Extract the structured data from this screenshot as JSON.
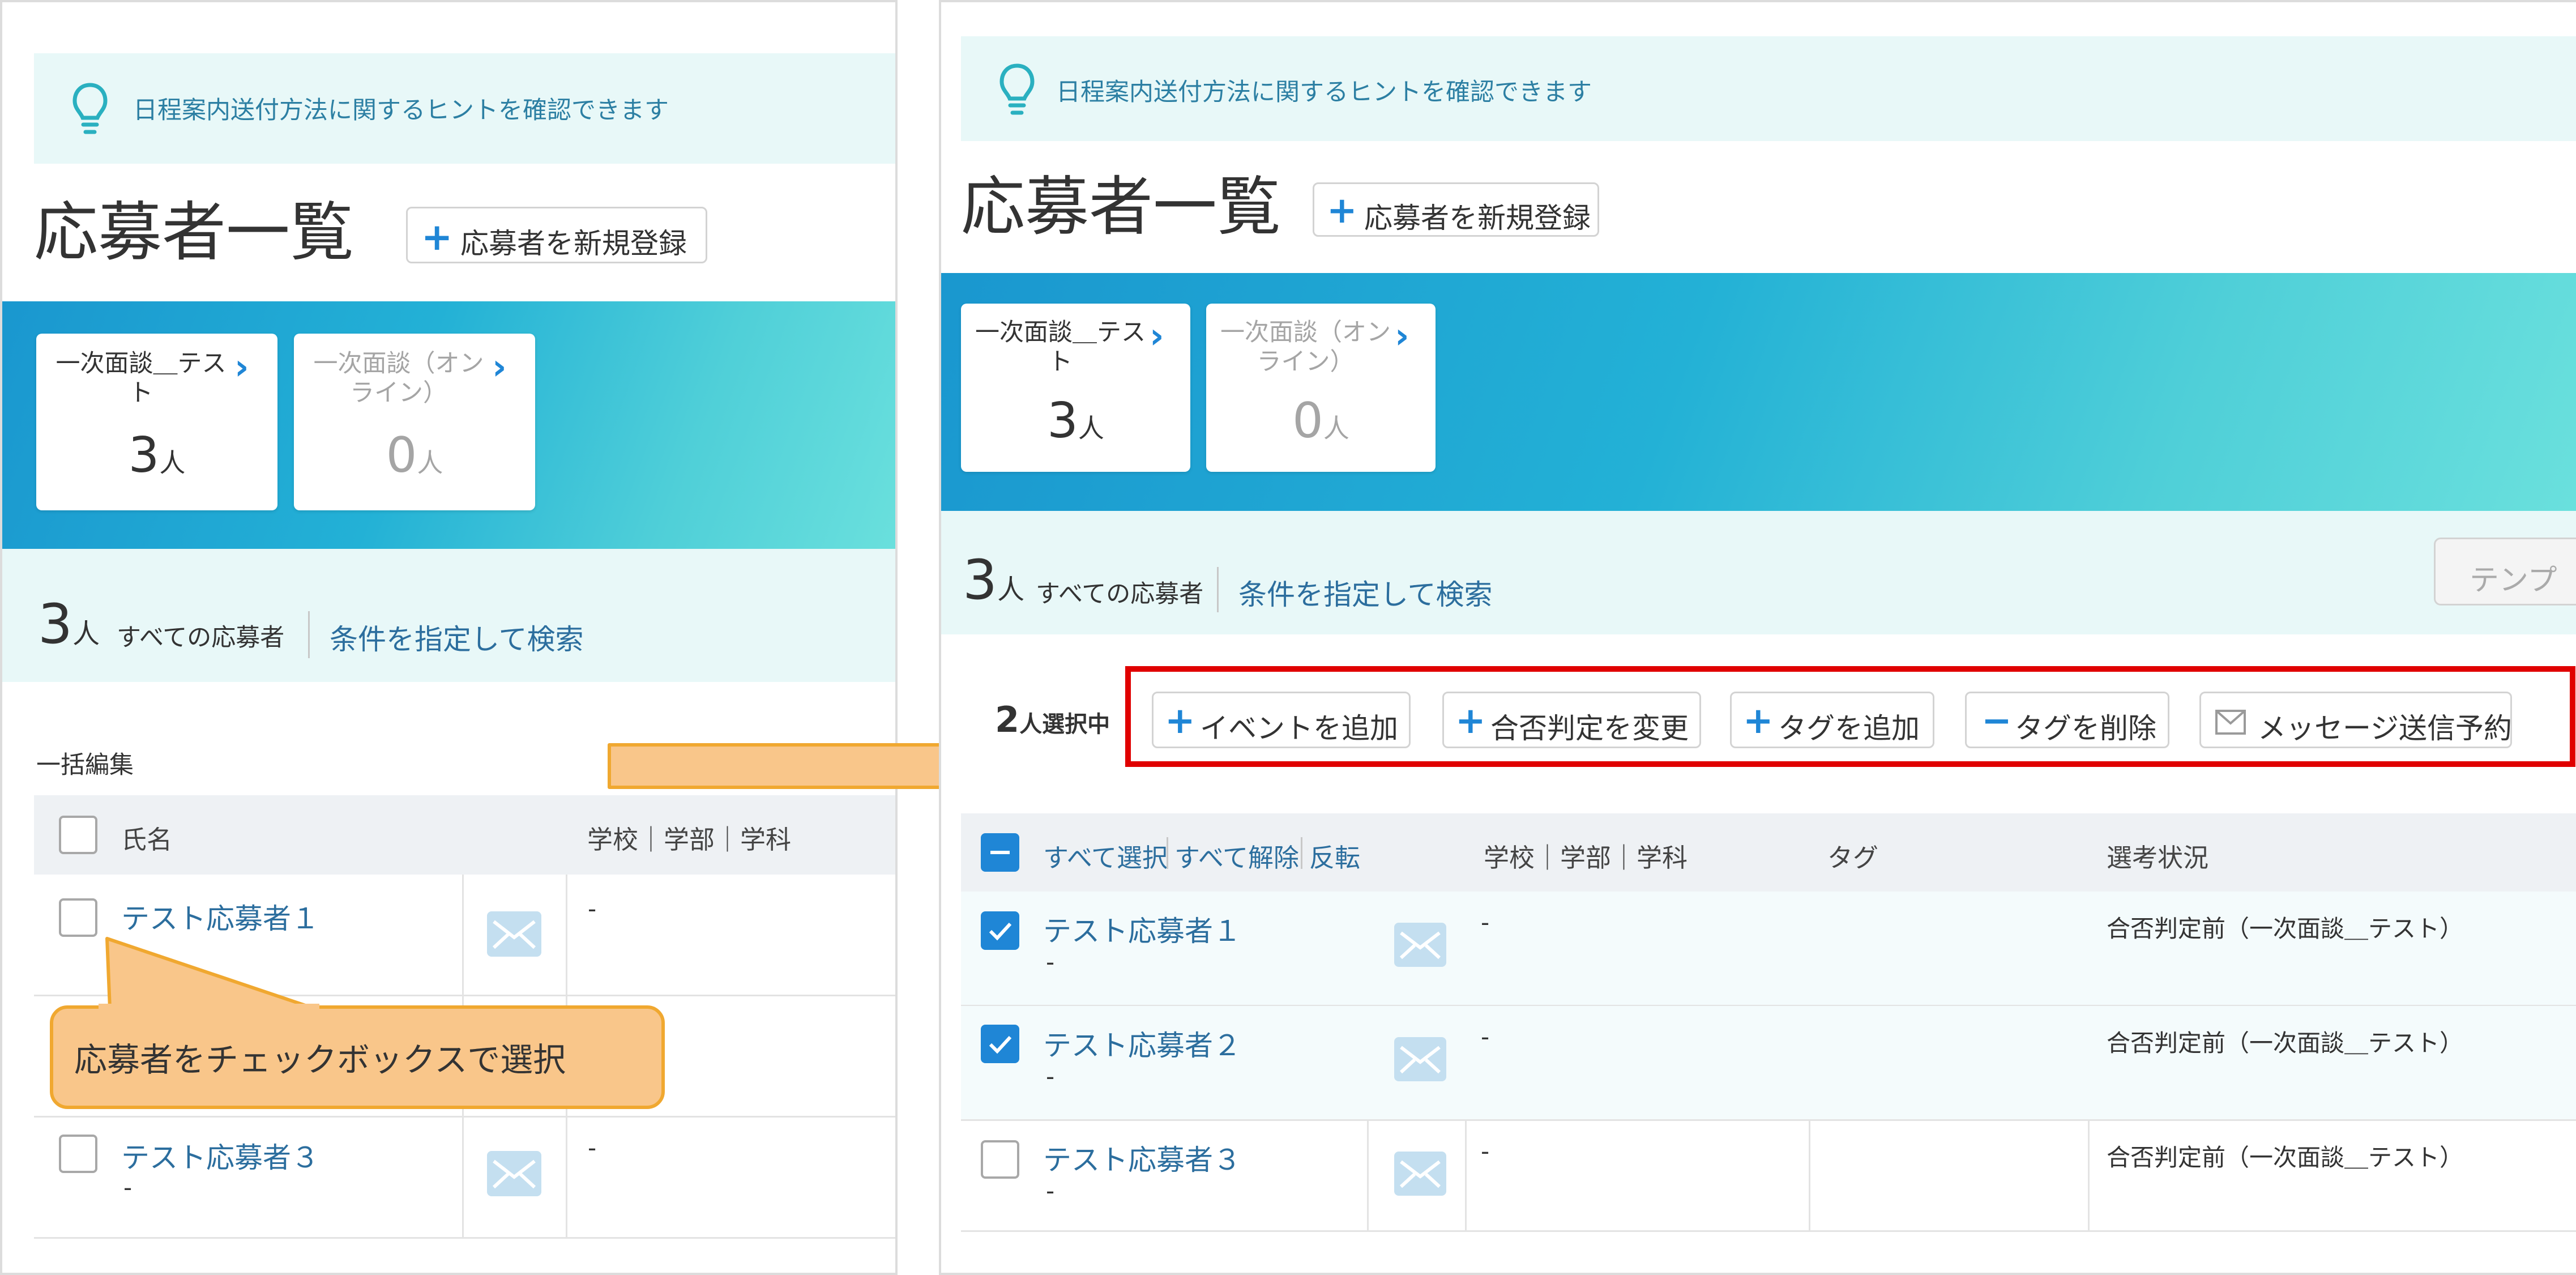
{
  "colors": {
    "accent": "#1f86d6",
    "link": "#2c6e9e",
    "highlight": "#e00000",
    "callout": "#f9c68a"
  },
  "hint_text": "日程案内送付方法に関するヒントを確認できます",
  "page_title": "応募者一覧",
  "register_label": "応募者を新規登録",
  "stages": [
    {
      "title_line1": "一次面談＿テス",
      "title_line2": "ト",
      "count": "3",
      "unit": "人"
    },
    {
      "title_line1": "一次面談（オン",
      "title_line2": "ライン）",
      "count": "0",
      "unit": "人"
    }
  ],
  "summary": {
    "count": "3",
    "unit": "人",
    "all_label": "すべての応募者",
    "search_link": "条件を指定して検索"
  },
  "template_button": "テンプ",
  "bulk_edit_label": "一括編集",
  "columns": {
    "name": "氏名",
    "school": "学校｜学部｜学科",
    "tag": "タグ",
    "status": "選考状況"
  },
  "selection": {
    "count": "2",
    "suffix": "人選択中",
    "select_all": "すべて選択",
    "deselect_all": "すべて解除",
    "invert": "反転"
  },
  "actions": {
    "add_event": "イベントを追加",
    "change_result": "合否判定を変更",
    "add_tag": "タグを追加",
    "remove_tag": "タグを削除",
    "schedule_message": "メッセージ送信予約"
  },
  "applicants": [
    {
      "name": "テスト応募者１",
      "sub": "-",
      "school": "-",
      "tag": "",
      "status": "合否判定前（一次面談＿テスト）",
      "checked_before": false,
      "checked_after": true
    },
    {
      "name": "テスト応募者２",
      "sub": "-",
      "school": "-",
      "tag": "",
      "status": "合否判定前（一次面談＿テスト）",
      "checked_before": false,
      "checked_after": true
    },
    {
      "name": "テスト応募者３",
      "sub": "-",
      "school": "-",
      "tag": "",
      "status": "合否判定前（一次面談＿テスト）",
      "checked_before": false,
      "checked_after": false
    }
  ],
  "callout_text": "応募者をチェックボックスで選択"
}
